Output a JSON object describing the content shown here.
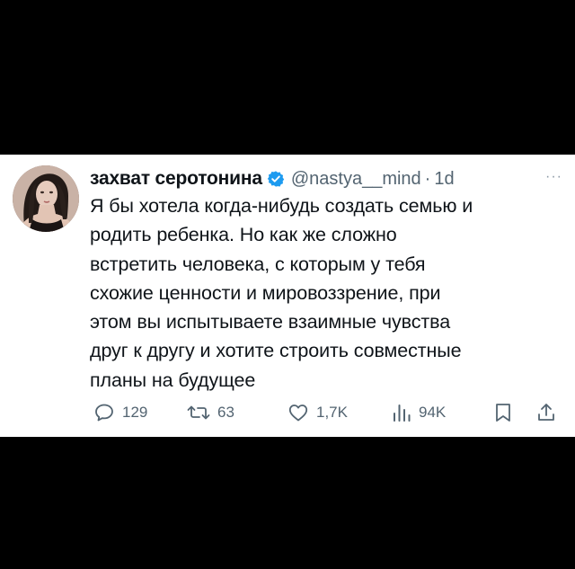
{
  "tweet": {
    "display_name": "захват серотонина",
    "verified": true,
    "handle": "@nastya__mind",
    "separator": "·",
    "time": "1d",
    "more_label": "···",
    "text_lines": [
      "Я бы хотела когда-нибудь создать семью и",
      "родить ребенка. Но как же сложно",
      "встретить человека, с которым у тебя",
      "схожие ценности и мировоззрение, при",
      "этом вы испытываете взаимные чувства",
      "друг к другу и хотите строить совместные",
      "планы на будущее"
    ]
  },
  "actions": {
    "reply": {
      "icon": "reply-icon",
      "count": "129"
    },
    "retweet": {
      "icon": "retweet-icon",
      "count": "63"
    },
    "like": {
      "icon": "heart-icon",
      "count": "1,7K"
    },
    "views": {
      "icon": "views-chart-icon",
      "count": "94K"
    },
    "bookmark": {
      "icon": "bookmark-icon"
    },
    "share": {
      "icon": "share-icon"
    }
  },
  "colors": {
    "background": "#000000",
    "card": "#ffffff",
    "text": "#0f1419",
    "muted": "#536471",
    "verified": "#1d9bf0"
  }
}
